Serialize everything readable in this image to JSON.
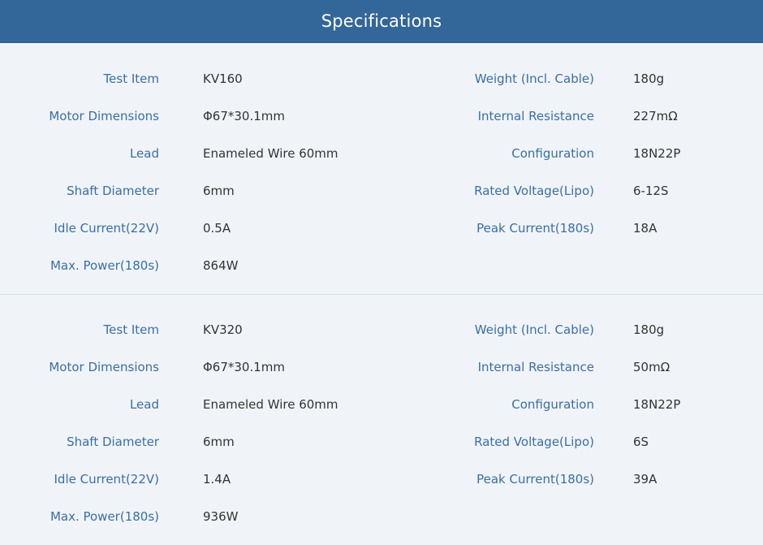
{
  "header": {
    "title": "Specifications"
  },
  "sections": [
    {
      "left": [
        {
          "label": "Test Item",
          "value": "KV160"
        },
        {
          "label": "Motor Dimensions",
          "value": "Φ67*30.1mm"
        },
        {
          "label": "Lead",
          "value": "Enameled Wire 60mm"
        },
        {
          "label": "Shaft Diameter",
          "value": "6mm"
        },
        {
          "label": "Idle Current(22V)",
          "value": "0.5A"
        },
        {
          "label": "Max. Power(180s)",
          "value": "864W"
        }
      ],
      "right": [
        {
          "label": "Weight (Incl. Cable)",
          "value": "180g"
        },
        {
          "label": "Internal Resistance",
          "value": "227mΩ"
        },
        {
          "label": "Configuration",
          "value": "18N22P"
        },
        {
          "label": "Rated Voltage(Lipo)",
          "value": "6-12S"
        },
        {
          "label": "Peak Current(180s)",
          "value": "18A"
        }
      ]
    },
    {
      "left": [
        {
          "label": "Test Item",
          "value": "KV320"
        },
        {
          "label": "Motor Dimensions",
          "value": "Φ67*30.1mm"
        },
        {
          "label": "Lead",
          "value": "Enameled Wire 60mm"
        },
        {
          "label": "Shaft Diameter",
          "value": "6mm"
        },
        {
          "label": "Idle Current(22V)",
          "value": "1.4A"
        },
        {
          "label": "Max. Power(180s)",
          "value": "936W"
        }
      ],
      "right": [
        {
          "label": "Weight (Incl. Cable)",
          "value": "180g"
        },
        {
          "label": "Internal Resistance",
          "value": "50mΩ"
        },
        {
          "label": "Configuration",
          "value": "18N22P"
        },
        {
          "label": "Rated Voltage(Lipo)",
          "value": "6S"
        },
        {
          "label": "Peak Current(180s)",
          "value": "39A"
        }
      ]
    }
  ]
}
